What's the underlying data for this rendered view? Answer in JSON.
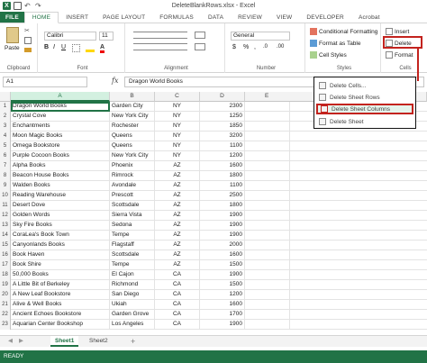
{
  "window": {
    "title": "DeleteBlankRows.xlsx - Excel",
    "app_logo": "X"
  },
  "tabs": [
    "FILE",
    "HOME",
    "INSERT",
    "PAGE LAYOUT",
    "FORMULAS",
    "DATA",
    "REVIEW",
    "VIEW",
    "DEVELOPER",
    "Acrobat"
  ],
  "ribbon": {
    "clipboard": {
      "paste": "Paste",
      "label": "Clipboard"
    },
    "font": {
      "name": "Calibri",
      "size": "11",
      "label": "Font"
    },
    "alignment": {
      "label": "Alignment"
    },
    "number": {
      "format": "General",
      "label": "Number",
      "currency": "$",
      "percent": "%",
      "comma": ",",
      "dec_inc": ".0",
      "dec_dec": ".00"
    },
    "styles": {
      "conditional": "Conditional Formatting",
      "format_table": "Format as Table",
      "cell_styles": "Cell Styles",
      "label": "Styles"
    },
    "cells": {
      "insert": "Insert",
      "delete": "Delete",
      "format": "Format",
      "label": "Cells"
    }
  },
  "formula_bar": {
    "name_box": "A1",
    "fx": "fx",
    "value": "Dragon World Books"
  },
  "columns": [
    "A",
    "B",
    "C",
    "D",
    "E"
  ],
  "rows": [
    {
      "n": "1",
      "a": "Dragon World Books",
      "b": "Garden City",
      "c": "NY",
      "d": "2300"
    },
    {
      "n": "2",
      "a": "Crystal Cove",
      "b": "New York City",
      "c": "NY",
      "d": "1250"
    },
    {
      "n": "3",
      "a": "Enchantments",
      "b": "Rochester",
      "c": "NY",
      "d": "1850"
    },
    {
      "n": "4",
      "a": "Moon Magic Books",
      "b": "Queens",
      "c": "NY",
      "d": "3200"
    },
    {
      "n": "5",
      "a": "Omega Bookstore",
      "b": "Queens",
      "c": "NY",
      "d": "1100"
    },
    {
      "n": "6",
      "a": "Purple Cocoon Books",
      "b": "New York City",
      "c": "NY",
      "d": "1200"
    },
    {
      "n": "7",
      "a": "Alpha Books",
      "b": "Phoenix",
      "c": "AZ",
      "d": "1600"
    },
    {
      "n": "8",
      "a": "Beacon House Books",
      "b": "Rimrock",
      "c": "AZ",
      "d": "1800"
    },
    {
      "n": "9",
      "a": "Walden Books",
      "b": "Avondale",
      "c": "AZ",
      "d": "1100"
    },
    {
      "n": "10",
      "a": "Reading Warehouse",
      "b": "Prescott",
      "c": "AZ",
      "d": "2500"
    },
    {
      "n": "11",
      "a": "Desert Dove",
      "b": "Scottsdale",
      "c": "AZ",
      "d": "1800"
    },
    {
      "n": "12",
      "a": "Golden Words",
      "b": "Sierra Vista",
      "c": "AZ",
      "d": "1900"
    },
    {
      "n": "13",
      "a": "Sky Fire Books",
      "b": "Sedona",
      "c": "AZ",
      "d": "1900"
    },
    {
      "n": "14",
      "a": "CoraLea's Book Town",
      "b": "Tempe",
      "c": "AZ",
      "d": "1900"
    },
    {
      "n": "15",
      "a": "Canyonlands Books",
      "b": "Flagstaff",
      "c": "AZ",
      "d": "2000"
    },
    {
      "n": "16",
      "a": "Book Haven",
      "b": "Scottsdale",
      "c": "AZ",
      "d": "1600"
    },
    {
      "n": "17",
      "a": "Book Shire",
      "b": "Tempe",
      "c": "AZ",
      "d": "1500"
    },
    {
      "n": "18",
      "a": "50,000 Books",
      "b": "El Cajon",
      "c": "CA",
      "d": "1900"
    },
    {
      "n": "19",
      "a": "A Little Bit of Berkeley",
      "b": "Richmond",
      "c": "CA",
      "d": "1500"
    },
    {
      "n": "20",
      "a": "A New Leaf Bookstore",
      "b": "San Diego",
      "c": "CA",
      "d": "1200"
    },
    {
      "n": "21",
      "a": "Alive & Well Books",
      "b": "Ukiah",
      "c": "CA",
      "d": "1600"
    },
    {
      "n": "22",
      "a": "Ancient Echoes Bookstore",
      "b": "Garden Grove",
      "c": "CA",
      "d": "1700"
    },
    {
      "n": "23",
      "a": "Aquarian Center Bookshop",
      "b": "Los Angeles",
      "c": "CA",
      "d": "1900"
    }
  ],
  "sheets": {
    "active": "Sheet1",
    "other": "Sheet2",
    "add": "+"
  },
  "statusbar": {
    "text": "READY"
  },
  "delete_menu": [
    "Delete Cells...",
    "Delete Sheet Rows",
    "Delete Sheet Columns",
    "Delete Sheet"
  ],
  "colors": {
    "excel_green": "#217346",
    "highlight_red": "#c3231e"
  }
}
